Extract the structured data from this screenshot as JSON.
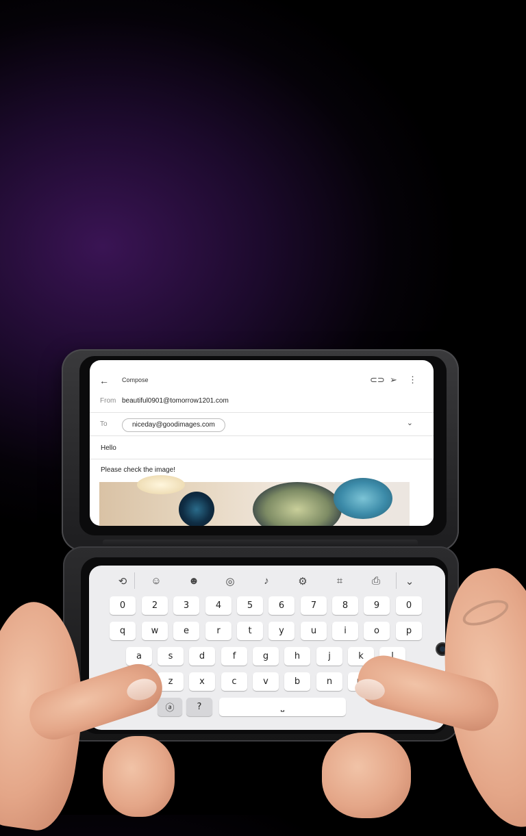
{
  "email": {
    "title": "Compose",
    "from_label": "From",
    "from_value": "beautiful0901@tomorrow1201.com",
    "to_label": "To",
    "to_value": "niceday@goodimages.com",
    "subject": "Hello",
    "body": "Please check the image!"
  },
  "keyboard": {
    "number_row": [
      "0",
      "2",
      "3",
      "4",
      "5",
      "6",
      "7",
      "8",
      "9",
      "0"
    ],
    "row1": [
      "q",
      "w",
      "e",
      "r",
      "t",
      "y",
      "u",
      "i",
      "o",
      "p"
    ],
    "row2": [
      "a",
      "s",
      "d",
      "f",
      "g",
      "h",
      "j",
      "k",
      "l"
    ],
    "row3": [
      "z",
      "x",
      "c",
      "v",
      "b",
      "n",
      "m"
    ],
    "sym_key": "?",
    "shift_key": "^",
    "space_key": "⎵"
  },
  "colors": {
    "bg_purple": "#3a1454",
    "screen_white": "#ffffff",
    "keyboard_bg": "#ededef"
  }
}
